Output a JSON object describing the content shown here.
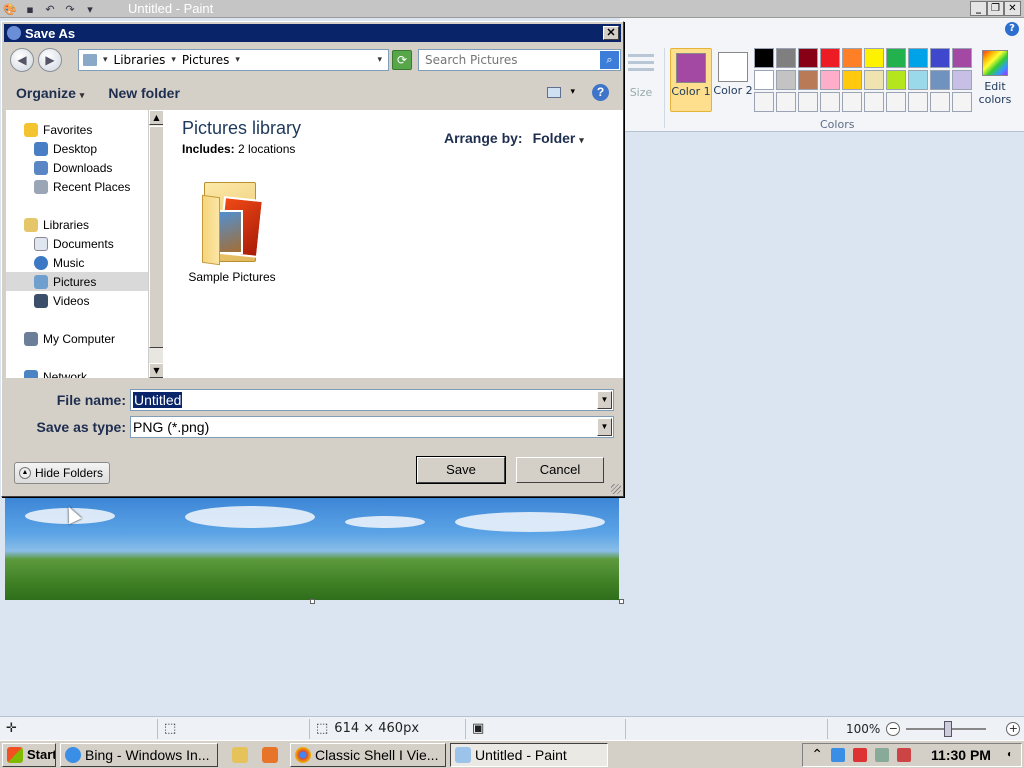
{
  "paint": {
    "title": "Untitled - Paint",
    "ribbon": {
      "size_label": "Size",
      "color1_label": "Color 1",
      "color2_label": "Color 2",
      "edit_colors_label": "Edit colors",
      "colors_group_label": "Colors",
      "color1_value": "#a349a4",
      "color2_value": "#ffffff",
      "palette": [
        "#000000",
        "#7f7f7f",
        "#880015",
        "#ed1c24",
        "#ff7f27",
        "#fff200",
        "#22b14c",
        "#00a2e8",
        "#3f48cc",
        "#a349a4",
        "#ffffff",
        "#c3c3c3",
        "#b97a57",
        "#ffaec9",
        "#ffc90e",
        "#efe4b0",
        "#b5e61d",
        "#99d9ea",
        "#7092be",
        "#c8bfe7",
        "#f4f4f4",
        "#f4f4f4",
        "#f4f4f4",
        "#f4f4f4",
        "#f4f4f4",
        "#f4f4f4",
        "#f4f4f4",
        "#f4f4f4",
        "#f4f4f4",
        "#f4f4f4"
      ]
    },
    "status": {
      "dimensions": "614 × 460px",
      "zoom": "100%"
    }
  },
  "dialog": {
    "title": "Save As",
    "address": [
      "Libraries",
      "Pictures"
    ],
    "search_placeholder": "Search Pictures",
    "organize_label": "Organize",
    "new_folder_label": "New folder",
    "nav": {
      "favorites": "Favorites",
      "desktop": "Desktop",
      "downloads": "Downloads",
      "recent_places": "Recent Places",
      "libraries": "Libraries",
      "documents": "Documents",
      "music": "Music",
      "pictures": "Pictures",
      "videos": "Videos",
      "my_computer": "My Computer",
      "network": "Network"
    },
    "library_title": "Pictures library",
    "includes_label": "Includes:",
    "includes_value": "2 locations",
    "arrange_label": "Arrange by:",
    "arrange_value": "Folder",
    "items": [
      {
        "label": "Sample Pictures"
      }
    ],
    "file_name_label": "File name:",
    "file_name_value": "Untitled",
    "save_type_label": "Save as type:",
    "save_type_value": "PNG (*.png)",
    "hide_folders_label": "Hide Folders",
    "save_label": "Save",
    "cancel_label": "Cancel"
  },
  "taskbar": {
    "start_label": "Start",
    "tasks": [
      {
        "label": "Bing - Windows In..."
      },
      {
        "label": "Classic Shell I Vie..."
      },
      {
        "label": "Untitled - Paint"
      }
    ],
    "clock": "11:30 PM"
  }
}
